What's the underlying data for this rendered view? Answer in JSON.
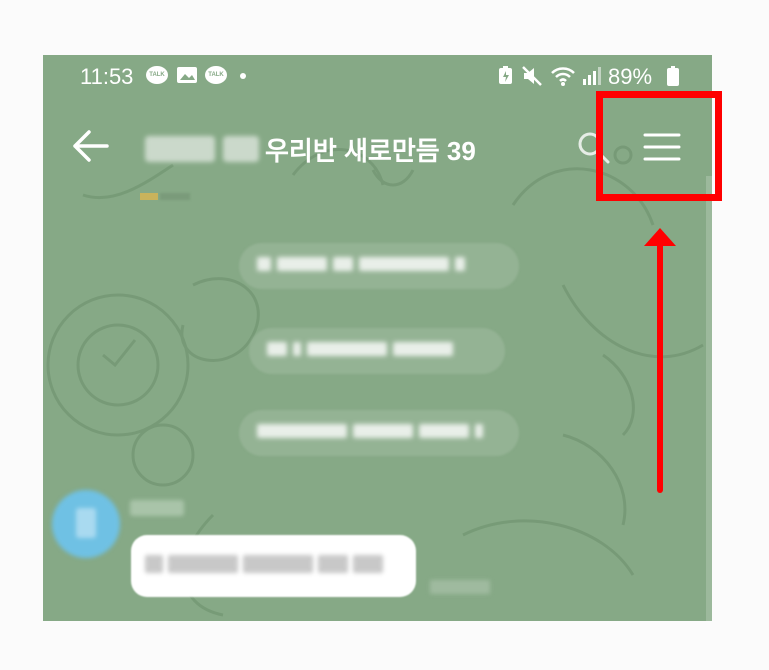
{
  "status_bar": {
    "time": "11:53",
    "notifications": [
      "talk-icon",
      "image-icon",
      "talk-icon",
      "dot"
    ],
    "talk_label": "TALK",
    "battery_percent": "89%"
  },
  "header": {
    "title": "우리반 새로만듬 39",
    "back_icon": "arrow-left-icon",
    "search_icon": "search-icon",
    "menu_icon": "hamburger-menu-icon"
  },
  "annotation": {
    "highlight_color": "#ff0000",
    "arrow_color": "#ff0000"
  },
  "theme": {
    "chat_background": "#86a986",
    "avatar_color": "#6fc1e4",
    "bubble_color": "#ffffff"
  }
}
